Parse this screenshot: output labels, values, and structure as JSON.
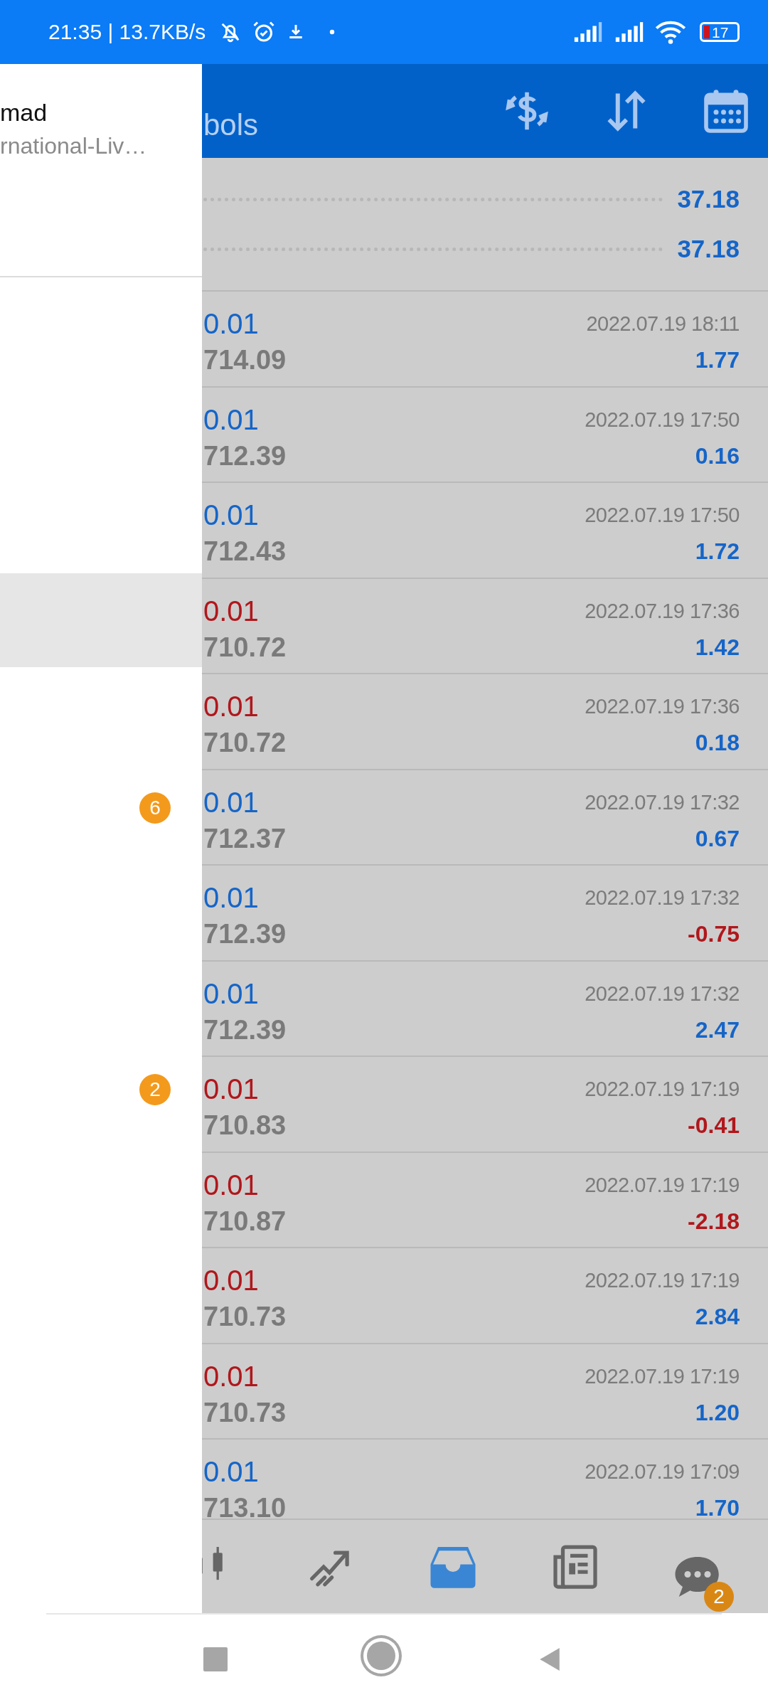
{
  "status_bar": {
    "text": "21:35 | 13.7KB/s",
    "battery": "17"
  },
  "app_bar": {
    "title": "bols"
  },
  "summary": [
    {
      "value": "37.18"
    },
    {
      "value": "37.18"
    }
  ],
  "trades": [
    {
      "color": "#1565c8",
      "lot": "0.01",
      "price": "714.09",
      "time": "2022.07.19 18:11",
      "profit": "1.77",
      "loss": false
    },
    {
      "color": "#1565c8",
      "lot": "0.01",
      "price": "712.39",
      "time": "2022.07.19 17:50",
      "profit": "0.16",
      "loss": false
    },
    {
      "color": "#1565c8",
      "lot": "0.01",
      "price": "712.43",
      "time": "2022.07.19 17:50",
      "profit": "1.72",
      "loss": false
    },
    {
      "color": "#b0171c",
      "lot": "0.01",
      "price": "710.72",
      "time": "2022.07.19 17:36",
      "profit": "1.42",
      "loss": false
    },
    {
      "color": "#b0171c",
      "lot": "0.01",
      "price": "710.72",
      "time": "2022.07.19 17:36",
      "profit": "0.18",
      "loss": false
    },
    {
      "color": "#1565c8",
      "lot": "0.01",
      "price": "712.37",
      "time": "2022.07.19 17:32",
      "profit": "0.67",
      "loss": false
    },
    {
      "color": "#1565c8",
      "lot": "0.01",
      "price": "712.39",
      "time": "2022.07.19 17:32",
      "profit": "-0.75",
      "loss": true
    },
    {
      "color": "#1565c8",
      "lot": "0.01",
      "price": "712.39",
      "time": "2022.07.19 17:32",
      "profit": "2.47",
      "loss": false
    },
    {
      "color": "#b0171c",
      "lot": "0.01",
      "price": "710.83",
      "time": "2022.07.19 17:19",
      "profit": "-0.41",
      "loss": true
    },
    {
      "color": "#b0171c",
      "lot": "0.01",
      "price": "710.87",
      "time": "2022.07.19 17:19",
      "profit": "-2.18",
      "loss": true
    },
    {
      "color": "#b0171c",
      "lot": "0.01",
      "price": "710.73",
      "time": "2022.07.19 17:19",
      "profit": "2.84",
      "loss": false
    },
    {
      "color": "#b0171c",
      "lot": "0.01",
      "price": "710.73",
      "time": "2022.07.19 17:19",
      "profit": "1.20",
      "loss": false
    },
    {
      "color": "#1565c8",
      "lot": "0.01",
      "price": "713.10",
      "time": "2022.07.19 17:09",
      "profit": "1.70",
      "loss": false
    }
  ],
  "bottom_nav": [
    {
      "kind": "chart",
      "selected": false
    },
    {
      "kind": "trade",
      "selected": false
    },
    {
      "kind": "history",
      "selected": true
    },
    {
      "kind": "news",
      "selected": false
    },
    {
      "kind": "chat",
      "selected": false,
      "badge": "2"
    }
  ],
  "drawer": {
    "name": "mad",
    "server": "rnational-Liv…",
    "items": [
      {
        "selected": false
      },
      {
        "selected": false
      },
      {
        "selected": false
      },
      {
        "selected": true
      },
      {
        "selected": false
      },
      {
        "selected": false,
        "badge": "6"
      },
      {
        "selected": false
      },
      {
        "selected": false
      },
      {
        "selected": false,
        "badge": "2"
      }
    ]
  }
}
